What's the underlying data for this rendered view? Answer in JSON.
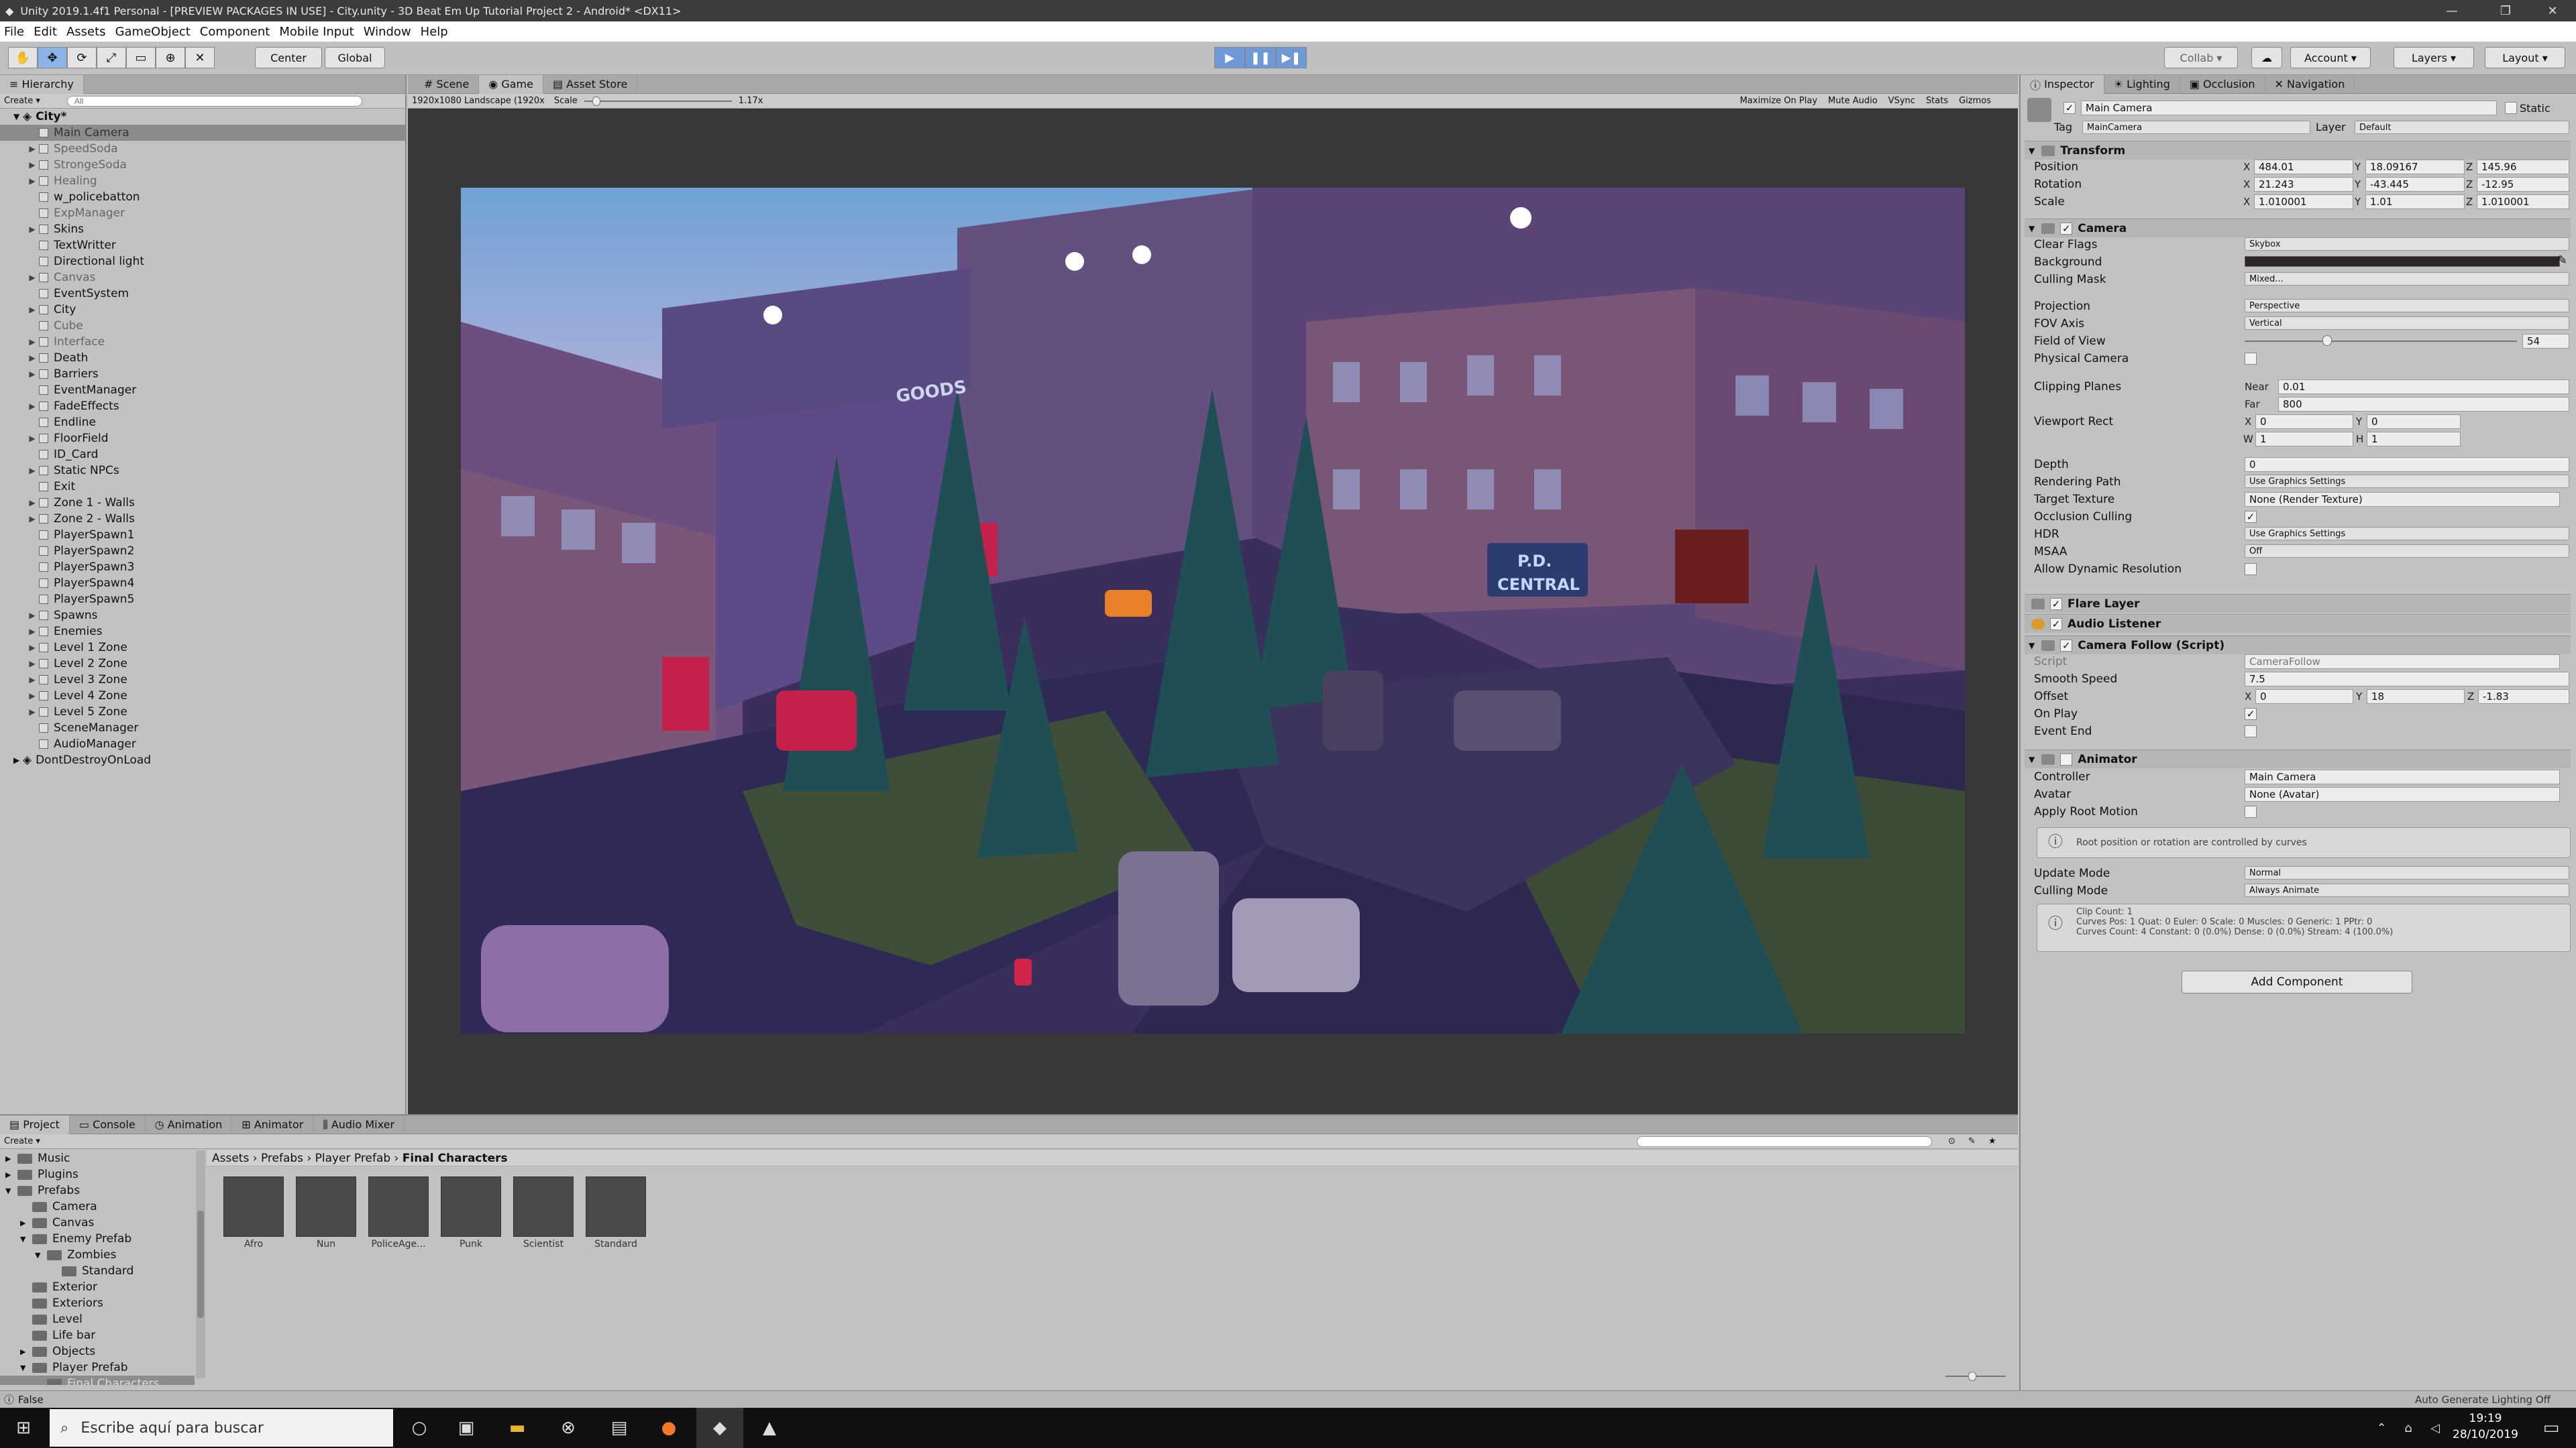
{
  "window": {
    "title": "Unity 2019.1.4f1 Personal - [PREVIEW PACKAGES IN USE] - City.unity - 3D Beat Em Up Tutorial Project 2 - Android* <DX11>"
  },
  "menu": [
    "File",
    "Edit",
    "Assets",
    "GameObject",
    "Component",
    "Mobile Input",
    "Window",
    "Help"
  ],
  "toolbar": {
    "center": "Center",
    "global": "Global",
    "collab": "Collab",
    "account": "Account",
    "layers": "Layers",
    "layout": "Layout"
  },
  "hierarchy": {
    "tab": "Hierarchy",
    "create": "Create",
    "search_placeholder": "All",
    "scene": "City*",
    "items": [
      {
        "label": "Main Camera",
        "exp": false,
        "dim": true,
        "sel": true
      },
      {
        "label": "SpeedSoda",
        "exp": true,
        "dim": true
      },
      {
        "label": "StrongeSoda",
        "exp": true,
        "dim": true
      },
      {
        "label": "Healing",
        "exp": true,
        "dim": true
      },
      {
        "label": "w_policebatton",
        "exp": false
      },
      {
        "label": "ExpManager",
        "exp": false,
        "dim": true
      },
      {
        "label": "Skins",
        "exp": true
      },
      {
        "label": "TextWritter",
        "exp": false
      },
      {
        "label": "Directional light",
        "exp": false
      },
      {
        "label": "Canvas",
        "exp": true,
        "dim": true
      },
      {
        "label": "EventSystem",
        "exp": false
      },
      {
        "label": "City",
        "exp": true
      },
      {
        "label": "Cube",
        "exp": false,
        "dim": true
      },
      {
        "label": "Interface",
        "exp": true,
        "dim": true
      },
      {
        "label": "Death",
        "exp": true
      },
      {
        "label": "Barriers",
        "exp": true
      },
      {
        "label": "EventManager",
        "exp": false
      },
      {
        "label": "FadeEffects",
        "exp": true
      },
      {
        "label": "Endline",
        "exp": false
      },
      {
        "label": "FloorField",
        "exp": true
      },
      {
        "label": "ID_Card",
        "exp": false
      },
      {
        "label": "Static NPCs",
        "exp": true
      },
      {
        "label": "Exit",
        "exp": false
      },
      {
        "label": "Zone 1 - Walls",
        "exp": true
      },
      {
        "label": "Zone 2 - Walls",
        "exp": true
      },
      {
        "label": "PlayerSpawn1",
        "exp": false
      },
      {
        "label": "PlayerSpawn2",
        "exp": false
      },
      {
        "label": "PlayerSpawn3",
        "exp": false
      },
      {
        "label": "PlayerSpawn4",
        "exp": false
      },
      {
        "label": "PlayerSpawn5",
        "exp": false
      },
      {
        "label": "Spawns",
        "exp": true
      },
      {
        "label": "Enemies",
        "exp": true
      },
      {
        "label": "Level 1 Zone",
        "exp": true
      },
      {
        "label": "Level 2 Zone",
        "exp": true
      },
      {
        "label": "Level 3 Zone",
        "exp": true
      },
      {
        "label": "Level 4 Zone",
        "exp": true
      },
      {
        "label": "Level 5 Zone",
        "exp": true
      },
      {
        "label": "SceneManager",
        "exp": false
      },
      {
        "label": "AudioManager",
        "exp": false
      }
    ],
    "dontdestroy": "DontDestroyOnLoad"
  },
  "game": {
    "tabs": [
      "Scene",
      "Game",
      "Asset Store"
    ],
    "resolution": "1920x1080 Landscape (1920x",
    "scale_label": "Scale",
    "scale_value": "1.17x",
    "options": [
      "Maximize On Play",
      "Mute Audio",
      "VSync",
      "Stats",
      "Gizmos"
    ],
    "sign_goods": "GOODS",
    "sign_pd": "P.D.",
    "sign_central": "CENTRAL"
  },
  "inspector": {
    "tabs": [
      "Inspector",
      "Lighting",
      "Occlusion",
      "Navigation"
    ],
    "object_name": "Main Camera",
    "static": "Static",
    "tag_label": "Tag",
    "tag": "MainCamera",
    "layer_label": "Layer",
    "layer": "Default",
    "transform": {
      "title": "Transform",
      "position": {
        "label": "Position",
        "x": "484.01",
        "y": "18.09167",
        "z": "145.96"
      },
      "rotation": {
        "label": "Rotation",
        "x": "21.243",
        "y": "-43.445",
        "z": "-12.95"
      },
      "scale": {
        "label": "Scale",
        "x": "1.010001",
        "y": "1.01",
        "z": "1.010001"
      }
    },
    "camera": {
      "title": "Camera",
      "clear_flags_label": "Clear Flags",
      "clear_flags": "Skybox",
      "background_label": "Background",
      "culling_mask_label": "Culling Mask",
      "culling_mask": "Mixed...",
      "projection_label": "Projection",
      "projection": "Perspective",
      "fov_axis_label": "FOV Axis",
      "fov_axis": "Vertical",
      "fov_label": "Field of View",
      "fov": "54",
      "physical_label": "Physical Camera",
      "clipping_label": "Clipping Planes",
      "near_label": "Near",
      "near": "0.01",
      "far_label": "Far",
      "far": "800",
      "viewport_label": "Viewport Rect",
      "vx": "0",
      "vy": "0",
      "vw": "1",
      "vh": "1",
      "depth_label": "Depth",
      "depth": "0",
      "rendering_path_label": "Rendering Path",
      "rendering_path": "Use Graphics Settings",
      "target_texture_label": "Target Texture",
      "target_texture": "None (Render Texture)",
      "occlusion_label": "Occlusion Culling",
      "hdr_label": "HDR",
      "hdr": "Use Graphics Settings",
      "msaa_label": "MSAA",
      "msaa": "Off",
      "dyn_res_label": "Allow Dynamic Resolution"
    },
    "flare": "Flare Layer",
    "audio_listener": "Audio Listener",
    "camera_follow": {
      "title": "Camera Follow (Script)",
      "script_label": "Script",
      "script": "CameraFollow",
      "smooth_label": "Smooth Speed",
      "smooth": "7.5",
      "offset_label": "Offset",
      "ox": "0",
      "oy": "18",
      "oz": "-1.83",
      "onplay_label": "On Play",
      "eventend_label": "Event End"
    },
    "animator": {
      "title": "Animator",
      "controller_label": "Controller",
      "controller": "Main Camera",
      "avatar_label": "Avatar",
      "avatar": "None (Avatar)",
      "root_motion_label": "Apply Root Motion",
      "help1": "Root position or rotation are controlled by curves",
      "update_label": "Update Mode",
      "update": "Normal",
      "culling_label": "Culling Mode",
      "culling": "Always Animate",
      "clip_info1": "Clip Count: 1",
      "clip_info2": "Curves Pos: 1 Quat: 0 Euler: 0 Scale: 0 Muscles: 0 Generic: 1 PPtr: 0",
      "clip_info3": "Curves Count: 4 Constant: 0 (0.0%) Dense: 0 (0.0%) Stream: 4 (100.0%)"
    },
    "add_component": "Add Component"
  },
  "project": {
    "tabs": [
      "Project",
      "Console",
      "Animation",
      "Animator",
      "Audio Mixer"
    ],
    "create": "Create",
    "tree": [
      {
        "label": "Music",
        "d": 1,
        "exp": true
      },
      {
        "label": "Plugins",
        "d": 1,
        "exp": true
      },
      {
        "label": "Prefabs",
        "d": 1,
        "open": true
      },
      {
        "label": "Camera",
        "d": 2
      },
      {
        "label": "Canvas",
        "d": 2,
        "exp": true
      },
      {
        "label": "Enemy Prefab",
        "d": 2,
        "open": true
      },
      {
        "label": "Zombies",
        "d": 3,
        "open": true
      },
      {
        "label": "Standard",
        "d": 4
      },
      {
        "label": "Exterior",
        "d": 2
      },
      {
        "label": "Exteriors",
        "d": 2
      },
      {
        "label": "Level",
        "d": 2
      },
      {
        "label": "Life bar",
        "d": 2
      },
      {
        "label": "Objects",
        "d": 2,
        "exp": true
      },
      {
        "label": "Player Prefab",
        "d": 2,
        "open": true
      },
      {
        "label": "Final Characters",
        "d": 3,
        "sel": true
      }
    ],
    "breadcrumb": [
      "Assets",
      "Prefabs",
      "Player Prefab",
      "Final Characters"
    ],
    "assets": [
      "Afro",
      "Nun",
      "PoliceAge...",
      "Punk",
      "Scientist",
      "Standard"
    ]
  },
  "status": {
    "left": "False",
    "right": "Auto Generate Lighting Off"
  },
  "taskbar": {
    "search": "Escribe aquí para buscar",
    "time": "19:19",
    "date": "28/10/2019"
  }
}
